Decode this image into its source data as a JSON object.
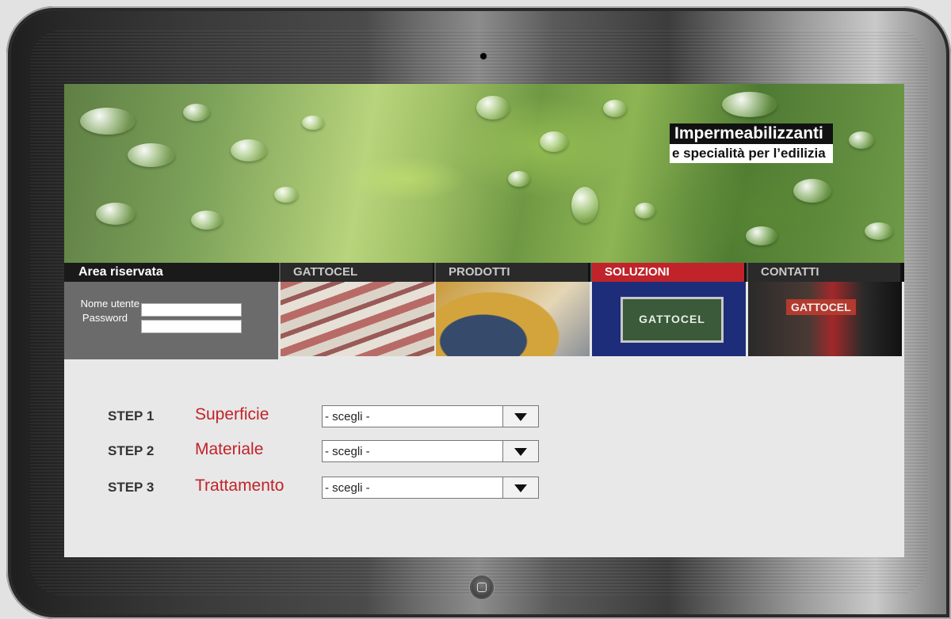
{
  "hero": {
    "line1": "Impermeabilizzanti",
    "line2": "e specialità per l’edilizia"
  },
  "nav": {
    "area_label": "Area riservata",
    "tabs": [
      {
        "label": "GATTOCEL",
        "active": false
      },
      {
        "label": "PRODOTTI",
        "active": false
      },
      {
        "label": "SOLUZIONI",
        "active": true
      },
      {
        "label": "CONTATTI",
        "active": false
      }
    ]
  },
  "login": {
    "username_label": "Nome utente",
    "password_label": "Password"
  },
  "thumbs": {
    "soluzioni_text": "GATTOCEL",
    "contatti_text": "GATTOCEL"
  },
  "steps": [
    {
      "num": "STEP 1",
      "name": "Superficie",
      "selected": "- scegli -"
    },
    {
      "num": "STEP 2",
      "name": "Materiale",
      "selected": "- scegli -"
    },
    {
      "num": "STEP 3",
      "name": "Trattamento",
      "selected": "- scegli -"
    }
  ],
  "colors": {
    "accent": "#c0242a",
    "nav_bg": "#111111",
    "login_bg": "#6b6b6b"
  }
}
